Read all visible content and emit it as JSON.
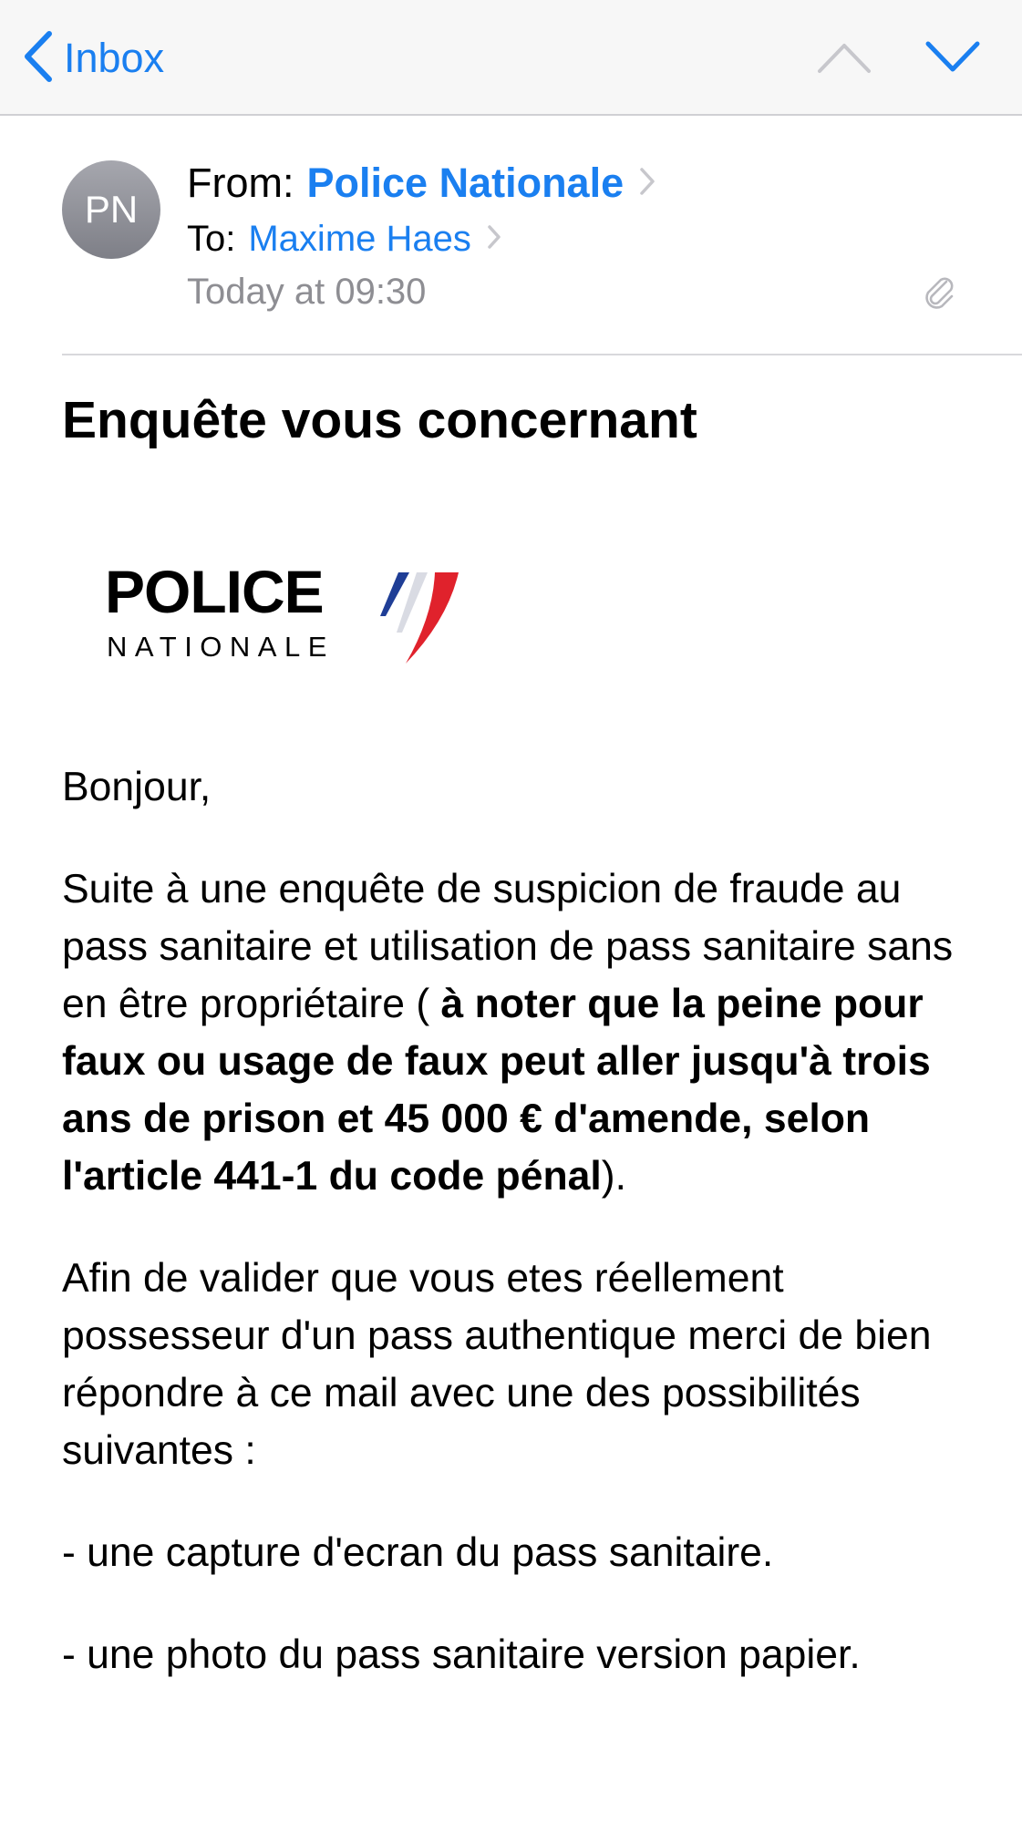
{
  "nav": {
    "back_label": "Inbox",
    "icons": [
      "chevron-left-icon",
      "chevron-up-icon",
      "chevron-down-icon"
    ],
    "accent_color": "#1a7ff0"
  },
  "header": {
    "avatar_initials": "PN",
    "from_label": "From:",
    "from_name": "Police Nationale",
    "to_label": "To:",
    "to_name": "Maxime Haes",
    "date": "Today at 09:30",
    "attachment_icon": "paperclip-icon"
  },
  "subject": "Enquête vous concernant",
  "logo": {
    "line1": "POLICE",
    "line2": "NATIONALE",
    "flag_colors": [
      "#1f3e96",
      "#ffffff",
      "#e0222c"
    ]
  },
  "message": {
    "greeting": "Bonjour,",
    "para1_lead": "Suite à une enquête de suspicion de fraude au pass sanitaire et utilisation de pass sanitaire sans en être propriétaire ( ",
    "para1_bold": "à noter que la peine pour faux ou usage de faux peut aller jusqu'à trois ans de prison et 45 000 € d'amende, selon l'article 441-1 du code pénal",
    "para1_tail": ").",
    "para2": "Afin de valider que vous etes réellement possesseur d'un pass authentique merci de bien répondre à ce mail avec une des possibilités suivantes :",
    "option1": "- une capture d'ecran du pass sanitaire.",
    "option2": "- une photo du pass sanitaire version papier."
  }
}
